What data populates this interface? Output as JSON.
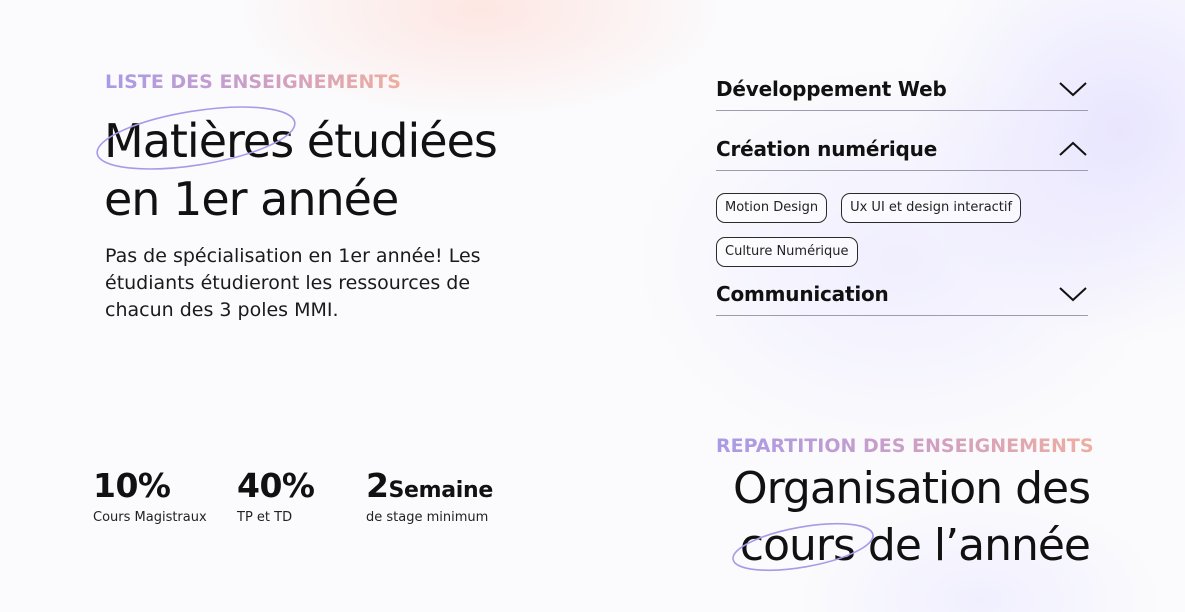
{
  "subjects": {
    "eyebrow": "LISTE DES ENSEIGNEMENTS",
    "title_line1_highlight": "Matières",
    "title_line1_rest": " étudiées",
    "title_line2": "en 1er année",
    "description": "Pas de spécialisation en 1er année! Les étudiants étudieront les ressources de chacun des 3 poles MMI."
  },
  "accordion": [
    {
      "title": "Développement Web",
      "expanded": false,
      "chevron_icon": "chevron-down-icon"
    },
    {
      "title": "Création numérique",
      "expanded": true,
      "chevron_icon": "chevron-up-icon",
      "tags": [
        "Motion Design",
        "Ux UI et design interactif",
        "Culture Numérique"
      ]
    },
    {
      "title": "Communication",
      "expanded": false,
      "chevron_icon": "chevron-down-icon"
    }
  ],
  "stats": [
    {
      "value": "10%",
      "suffix": "",
      "label": "Cours Magistraux"
    },
    {
      "value": "40%",
      "suffix": "",
      "label": "TP et TD"
    },
    {
      "value": "2",
      "suffix": "Semaine",
      "label": "de stage minimum"
    }
  ],
  "organization": {
    "eyebrow": "REPARTITION DES ENSEIGNEMENTS",
    "title_line1": "Organisation des",
    "title_line2_highlight": "cours",
    "title_line2_rest": " de l’année"
  },
  "colors": {
    "ring_stroke": "#a79be8",
    "eyebrow_gradient_start": "#a99ae6",
    "eyebrow_gradient_end": "#eeae9f",
    "divider": "#9e9bb0"
  }
}
